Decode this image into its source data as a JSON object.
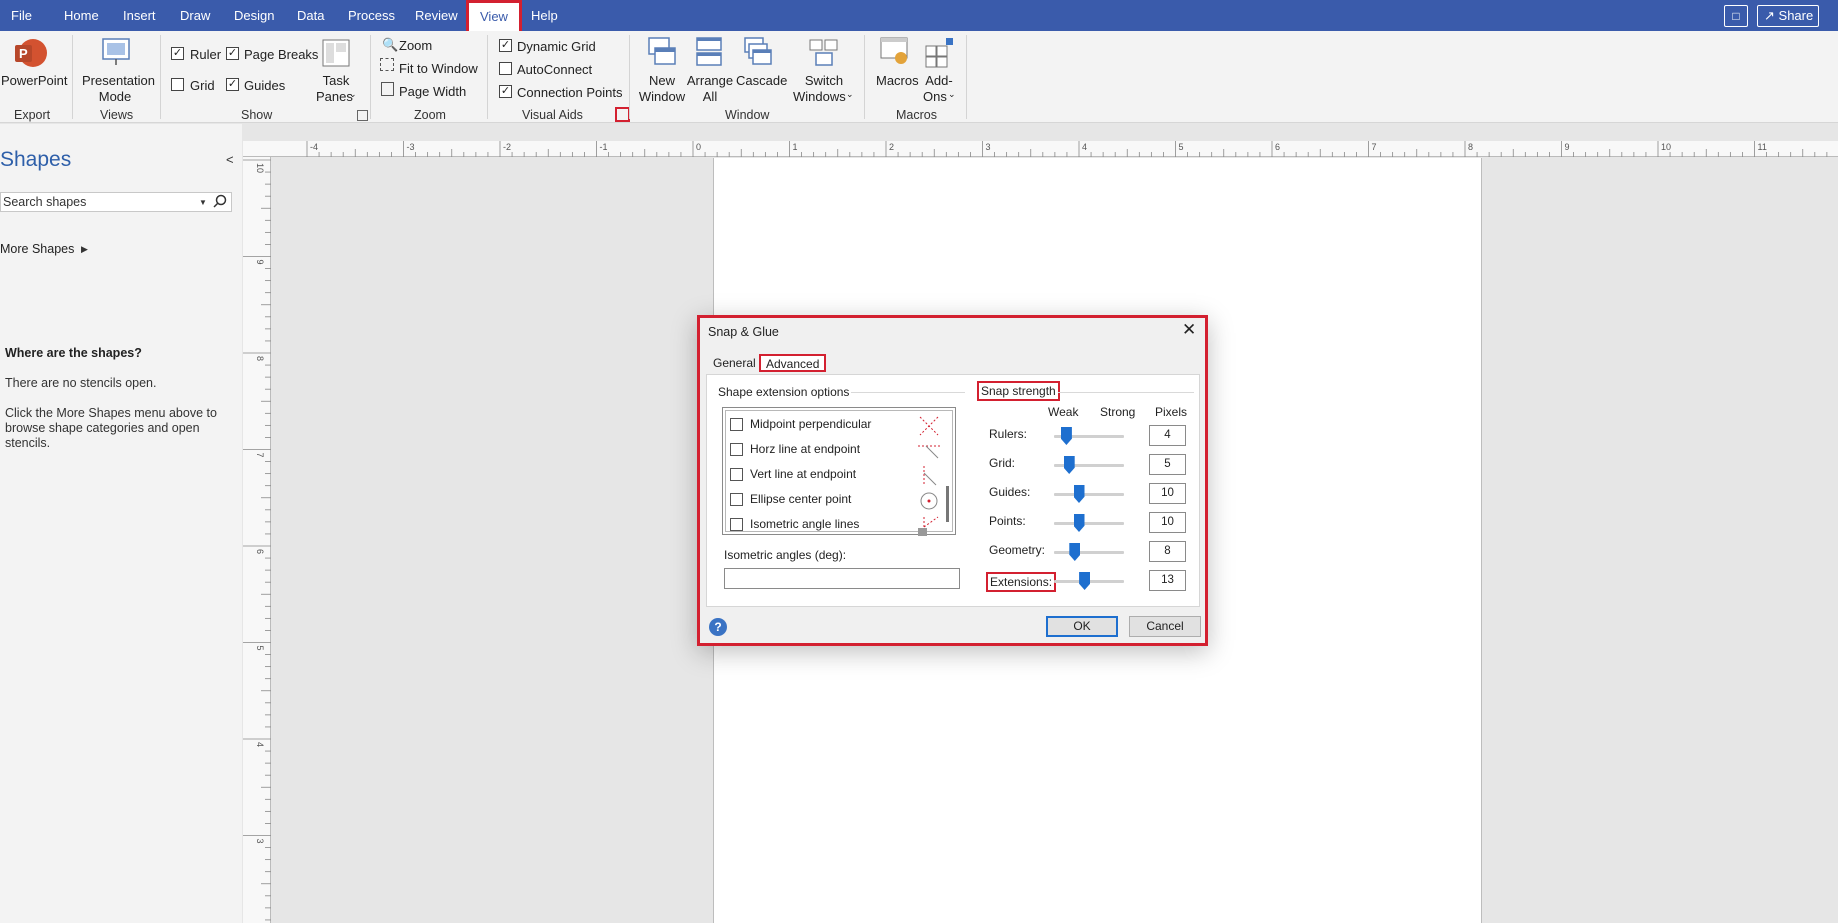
{
  "menu": {
    "items": [
      "File",
      "Home",
      "Insert",
      "Draw",
      "Design",
      "Data",
      "Process",
      "Review",
      "View",
      "Help"
    ],
    "active": "View",
    "share_label": "Share"
  },
  "ribbon": {
    "export": {
      "powerpoint_label": "PowerPoint",
      "group_label": "Export"
    },
    "views": {
      "presentation_label_1": "Presentation",
      "presentation_label_2": "Mode",
      "group_label": "Views"
    },
    "show": {
      "ruler_label": "Ruler",
      "ruler_checked": true,
      "page_breaks_label": "Page Breaks",
      "page_breaks_checked": true,
      "grid_label": "Grid",
      "grid_checked": false,
      "guides_label": "Guides",
      "guides_checked": true,
      "task_panes_label_1": "Task",
      "task_panes_label_2": "Panes",
      "group_label": "Show"
    },
    "zoom": {
      "zoom_label": "Zoom",
      "fit_label": "Fit to Window",
      "page_width_label": "Page Width",
      "group_label": "Zoom"
    },
    "visual_aids": {
      "dynamic_grid_label": "Dynamic Grid",
      "dynamic_grid_checked": true,
      "autoconnect_label": "AutoConnect",
      "autoconnect_checked": false,
      "connection_points_label": "Connection Points",
      "connection_points_checked": true,
      "group_label": "Visual Aids"
    },
    "window": {
      "new_window_1": "New",
      "new_window_2": "Window",
      "arrange_all_1": "Arrange",
      "arrange_all_2": "All",
      "cascade_label": "Cascade",
      "switch_1": "Switch",
      "switch_2": "Windows",
      "group_label": "Window"
    },
    "macros": {
      "macros_label": "Macros",
      "addons_1": "Add-",
      "addons_2": "Ons",
      "group_label": "Macros"
    }
  },
  "left_panel": {
    "title": "Shapes",
    "search_placeholder": "Search shapes",
    "more_shapes": "More Shapes",
    "where_heading": "Where are the shapes?",
    "no_stencils": "There are no stencils open.",
    "instructions": "Click the More Shapes menu above to browse shape categories and open stencils."
  },
  "rulers": {
    "top": [
      "-4",
      "-3",
      "-2",
      "-1",
      "0",
      "1",
      "2",
      "3",
      "4",
      "5",
      "6",
      "7",
      "8",
      "9",
      "10",
      "11"
    ],
    "left": [
      "10",
      "9",
      "8",
      "7",
      "6",
      "5",
      "4",
      "3"
    ]
  },
  "dialog": {
    "title": "Snap & Glue",
    "tabs": [
      "General",
      "Advanced"
    ],
    "active_tab": "Advanced",
    "shape_extension_label": "Shape extension options",
    "extension_options": [
      {
        "label": "Midpoint perpendicular",
        "checked": false
      },
      {
        "label": "Horz line at endpoint",
        "checked": false
      },
      {
        "label": "Vert line at endpoint",
        "checked": false
      },
      {
        "label": "Ellipse center point",
        "checked": false
      },
      {
        "label": "Isometric angle lines",
        "checked": false
      }
    ],
    "isometric_label": "Isometric angles (deg):",
    "isometric_value": "",
    "snap_strength_label": "Snap strength",
    "col_weak": "Weak",
    "col_strong": "Strong",
    "col_pixels": "Pixels",
    "sliders": [
      {
        "label": "Rulers:",
        "value": 4,
        "level": 0.17
      },
      {
        "label": "Grid:",
        "value": 5,
        "level": 0.21
      },
      {
        "label": "Guides:",
        "value": 10,
        "level": 0.35
      },
      {
        "label": "Points:",
        "value": 10,
        "level": 0.35
      },
      {
        "label": "Geometry:",
        "value": 8,
        "level": 0.29
      },
      {
        "label": "Extensions:",
        "value": 13,
        "level": 0.43
      }
    ],
    "ok_label": "OK",
    "cancel_label": "Cancel"
  },
  "colors": {
    "accent": "#3a5bab",
    "highlight": "#d32030",
    "slider": "#1e6fcf"
  }
}
